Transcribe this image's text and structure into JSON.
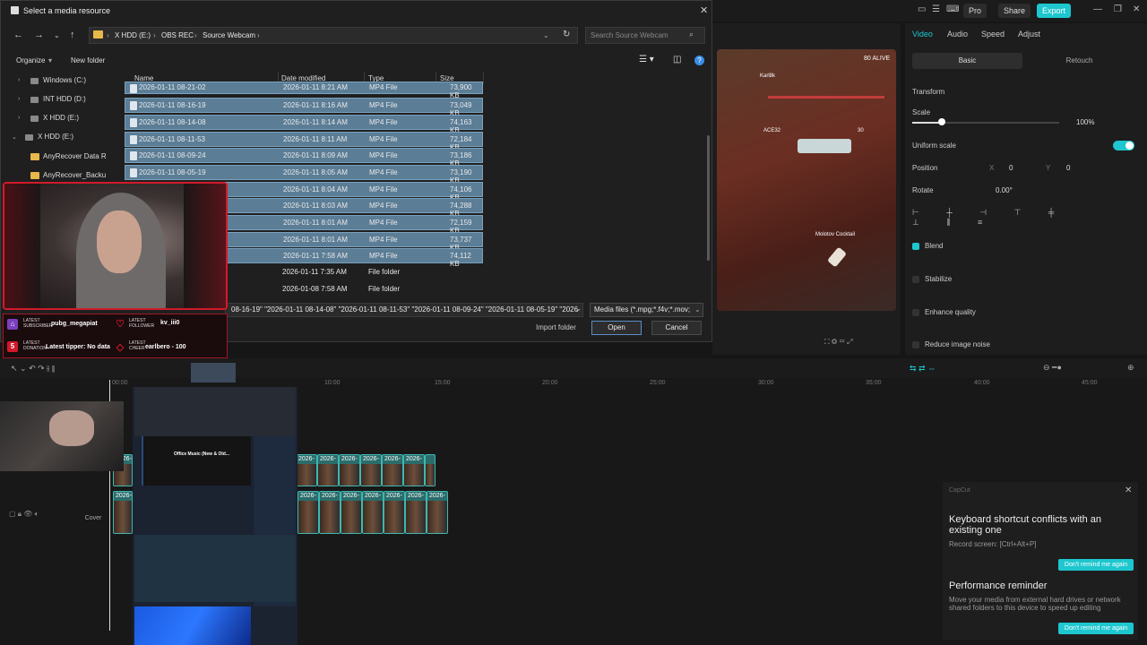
{
  "dialog": {
    "title": "Select a media resource",
    "breadcrumb": [
      "X HDD (E:)",
      "OBS REC",
      "Source Webcam"
    ],
    "search_placeholder": "Search Source Webcam",
    "toolbar": {
      "organize": "Organize",
      "new_folder": "New folder"
    },
    "columns": {
      "name": "Name",
      "date": "Date modified",
      "type": "Type",
      "size": "Size"
    },
    "tree": [
      {
        "label": "Windows (C:)",
        "kind": "drive"
      },
      {
        "label": "INT HDD (D:)",
        "kind": "drive"
      },
      {
        "label": "X HDD (E:)",
        "kind": "drive"
      },
      {
        "label": "X HDD (E:)",
        "kind": "drive-expanded"
      },
      {
        "label": "AnyRecover Data R",
        "kind": "folder"
      },
      {
        "label": "AnyRecover_Backu",
        "kind": "folder"
      }
    ],
    "files": [
      {
        "name": "2026-01-11 08-21-02",
        "date": "2026-01-11 8:21 AM",
        "type": "MP4 File",
        "size": "73,900 KB"
      },
      {
        "name": "2026-01-11 08-16-19",
        "date": "2026-01-11 8:16 AM",
        "type": "MP4 File",
        "size": "73,049 KB"
      },
      {
        "name": "2026-01-11 08-14-08",
        "date": "2026-01-11 8:14 AM",
        "type": "MP4 File",
        "size": "74,163 KB"
      },
      {
        "name": "2026-01-11 08-11-53",
        "date": "2026-01-11 8:11 AM",
        "type": "MP4 File",
        "size": "72,184 KB"
      },
      {
        "name": "2026-01-11 08-09-24",
        "date": "2026-01-11 8:09 AM",
        "type": "MP4 File",
        "size": "73,186 KB"
      },
      {
        "name": "2026-01-11 08-05-19",
        "date": "2026-01-11 8:05 AM",
        "type": "MP4 File",
        "size": "73,190 KB"
      },
      {
        "name": "",
        "date": "2026-01-11 8:04 AM",
        "type": "MP4 File",
        "size": "74,106 KB"
      },
      {
        "name": "",
        "date": "2026-01-11 8:03 AM",
        "type": "MP4 File",
        "size": "74,288 KB"
      },
      {
        "name": "",
        "date": "2026-01-11 8:01 AM",
        "type": "MP4 File",
        "size": "72,159 KB"
      },
      {
        "name": "",
        "date": "2026-01-11 8:01 AM",
        "type": "MP4 File",
        "size": "73,737 KB"
      },
      {
        "name": "",
        "date": "2026-01-11 7:58 AM",
        "type": "MP4 File",
        "size": "74,112 KB"
      },
      {
        "name": "",
        "date": "2026-01-11 7:35 AM",
        "type": "File folder",
        "size": ""
      },
      {
        "name": "",
        "date": "2026-01-08 7:58 AM",
        "type": "File folder",
        "size": ""
      }
    ],
    "file_name_value": "08-16-19\" \"2026-01-11 08-14-08\" \"2026-01-11 08-11-53\" \"2026-01-11 08-09-24\" \"2026-01-11 08-05-19\" \"2026-",
    "filter_value": "Media files (*.mpg;*.f4v;*.mov;",
    "import_folder": "Import folder",
    "open": "Open",
    "cancel": "Cancel"
  },
  "stream_overlay": {
    "subscriber_label": "LATEST SUBSCRIBER",
    "subscriber": "pubg_megapiat",
    "follower_label": "LATEST FOLLOWER",
    "follower": "kv_iii0",
    "donation_label": "LATEST DONATION",
    "tipper": "Latest tipper: No data",
    "cheer_label": "LATEST CHEER",
    "cheer": "earlbero - 100",
    "donation_badge": "5",
    "music_title": "Office Music (New & Old..."
  },
  "editor": {
    "top": {
      "pro": "Pro",
      "share": "Share",
      "export": "Export"
    },
    "props_tabs": [
      "Video",
      "Audio",
      "Speed",
      "Adjust"
    ],
    "sub_tabs": {
      "basic": "Basic",
      "retouch": "Retouch"
    },
    "transform": "Transform",
    "scale_label": "Scale",
    "scale_value": "100%",
    "scale_fraction": 0.2,
    "uniform_scale": "Uniform scale",
    "position_label": "Position",
    "pos_x_label": "X",
    "pos_x": "0",
    "pos_y_label": "Y",
    "pos_y": "0",
    "rotate_label": "Rotate",
    "rotate_value": "0.00°",
    "blend": "Blend",
    "stabilize": "Stabilize",
    "enhance_quality": "Enhance quality",
    "reduce_noise": "Reduce image noise",
    "game_hud": {
      "alive": "80 ALIVE",
      "player1": "Karl8k",
      "player2": "ACE32",
      "ammo": "30",
      "item": "Molotov Cocktail"
    },
    "ruler": [
      "00:00",
      "10:00",
      "15:00",
      "20:00",
      "25:00",
      "30:00",
      "35:00",
      "40:00",
      "45:00"
    ],
    "clip_label": "2026-",
    "cover": "Cover",
    "notifications": {
      "app": "CapCut",
      "n1_title": "Keyboard shortcut conflicts with an existing one",
      "n1_text": "Record screen: [Ctrl+Alt+P]",
      "btn": "Don't remind me again",
      "n2_title": "Performance reminder",
      "n2_text": "Move your media from external hard drives or network shared folders to this device to speed up editing"
    }
  }
}
